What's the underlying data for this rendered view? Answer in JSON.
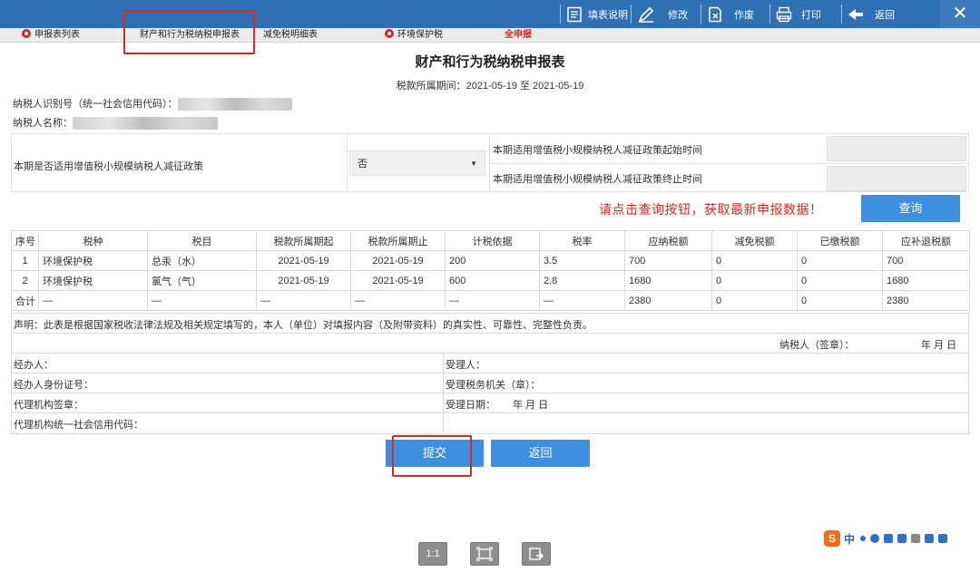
{
  "toolbar": {
    "fill_guide": "填表说明",
    "modify": "修改",
    "void": "作废",
    "print": "打印",
    "back": "返回",
    "close": "✕"
  },
  "tabs": [
    {
      "label": "申报表列表",
      "icon": "gear-icon"
    },
    {
      "label": "财产和行为税纳税申报表"
    },
    {
      "label": "减免税明细表"
    },
    {
      "label": "环境保护税",
      "icon": "gear-icon"
    },
    {
      "label": "全申报"
    }
  ],
  "header": {
    "title": "财产和行为税纳税申报表",
    "period_label": "税款所属期间：",
    "period_value": "2021-05-19 至 2021-05-19"
  },
  "taxpayer": {
    "id_label": "纳税人识别号（统一社会信用代码）：",
    "name_label": "纳税人名称："
  },
  "policy": {
    "question": "本期是否适用增值税小规模纳税人减征政策",
    "selected": "否",
    "start_label": "本期适用增值税小规模纳税人减征政策起始时间",
    "end_label": "本期适用增值税小规模纳税人减征政策终止时间"
  },
  "notice": "请点击查询按钮，获取最新申报数据！",
  "query_button": "查询",
  "table": {
    "headers": [
      "序号",
      "税种",
      "税目",
      "税款所属期起",
      "税款所属期止",
      "计税依据",
      "税率",
      "应纳税额",
      "减免税额",
      "已缴税额",
      "应补退税额"
    ],
    "rows": [
      [
        "1",
        "环境保护税",
        "总汞（水）",
        "2021-05-19",
        "2021-05-19",
        "200",
        "3.5",
        "700",
        "0",
        "0",
        "700"
      ],
      [
        "2",
        "环境保护税",
        "氯气（气）",
        "2021-05-19",
        "2021-05-19",
        "600",
        "2.8",
        "1680",
        "0",
        "0",
        "1680"
      ]
    ],
    "total": [
      "合计",
      "—",
      "—",
      "—",
      "—",
      "—",
      "—",
      "2380",
      "0",
      "0",
      "2380"
    ]
  },
  "footer": {
    "declaration": "声明：此表是根据国家税收法律法规及相关规定填写的，本人（单位）对填报内容（及附带资料）的真实性、可靠性、完整性负责。",
    "taxpayer_seal": "纳税人（签章）：",
    "date_ymd": "年  月  日",
    "agent": "经办人：",
    "receiver": "受理人：",
    "agent_id": "经办人身份证号：",
    "tax_office": "受理税务机关（章）：",
    "agency_seal": "代理机构签章：",
    "accept_date": "受理日期：",
    "accept_date_value": "年  月  日",
    "agency_code": "代理机构统一社会信用代码："
  },
  "actions": {
    "submit": "提交",
    "back": "返回"
  },
  "bottom_tools": [
    "1:1"
  ],
  "ime": {
    "logo": "S",
    "mode": "中"
  }
}
